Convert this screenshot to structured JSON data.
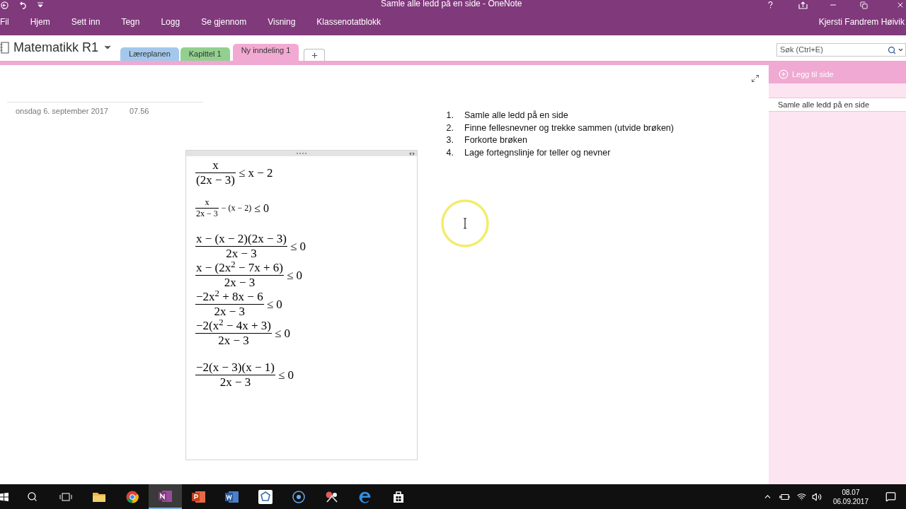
{
  "window": {
    "title": "Samle alle ledd på en side - OneNote"
  },
  "ribbon": {
    "tabs": [
      {
        "label": "Fil",
        "selected": false
      },
      {
        "label": "Hjem",
        "selected": false
      },
      {
        "label": "Sett inn",
        "selected": false
      },
      {
        "label": "Tegn",
        "selected": false
      },
      {
        "label": "Logg",
        "selected": false
      },
      {
        "label": "Se gjennom",
        "selected": false
      },
      {
        "label": "Visning",
        "selected": false
      },
      {
        "label": "Klassenotatblokk",
        "selected": false
      }
    ],
    "user": "Kjersti Fandrem Høivik"
  },
  "notebook": {
    "name": "Matematikk R1"
  },
  "sections": [
    {
      "label": "Læreplanen",
      "color": "#a4c8ec",
      "selected": false
    },
    {
      "label": "Kapittel 1",
      "color": "#93d08f",
      "selected": false
    },
    {
      "label": "Ny inndeling 1",
      "color": "#f2aad3",
      "selected": true
    }
  ],
  "search": {
    "placeholder": "Søk (Ctrl+E)"
  },
  "page": {
    "date": "onsdag 6. september 2017",
    "time": "07.56",
    "equations": [
      {
        "kind": "display",
        "numerator": "x",
        "denominator": "(2x − 3)",
        "relation": "≤ x − 2"
      },
      {
        "kind": "inline",
        "numerator": "x",
        "denominator": "2x − 3",
        "tail": "− (x − 2)",
        "relation": "≤ 0"
      },
      {
        "kind": "display",
        "numerator": "x − (x − 2)(2x − 3)",
        "denominator": "2x − 3",
        "relation": "≤ 0"
      },
      {
        "kind": "display",
        "numerator": "x − (2x$^{2}$ − 7x + 6)",
        "denominator": "2x − 3",
        "relation": "≤ 0"
      },
      {
        "kind": "display",
        "numerator": "−2x$^{2}$ + 8x − 6",
        "denominator": "2x − 3",
        "relation": "≤ 0"
      },
      {
        "kind": "display",
        "numerator": "−2(x$^{2}$ − 4x + 3)",
        "denominator": "2x − 3",
        "relation": "≤ 0"
      },
      {
        "kind": "display",
        "numerator": "−2(x − 3)(x − 1)",
        "denominator": "2x − 3",
        "relation": "≤ 0"
      }
    ],
    "steps": [
      {
        "number": "1.",
        "text": "Samle alle ledd på en side"
      },
      {
        "number": "2.",
        "text": "Finne fellesnevner og trekke sammen (utvide brøken)"
      },
      {
        "number": "3.",
        "text": "Forkorte brøken"
      },
      {
        "number": "4.",
        "text": "Lage fortegnslinje for teller og nevner"
      }
    ]
  },
  "pages_pane": {
    "add_label": "Legg til side",
    "pages": [
      {
        "title": "Samle alle ledd på en side",
        "selected": true
      }
    ]
  },
  "taskbar": {
    "time": "08.07",
    "date": "06.09.2017"
  }
}
